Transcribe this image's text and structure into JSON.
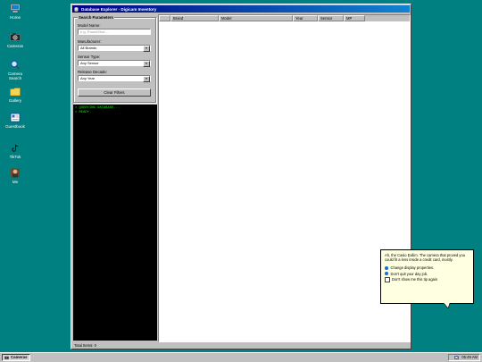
{
  "desktop": {
    "icons": [
      {
        "label": "Home",
        "icon": "computer-icon"
      },
      {
        "label": "Cameras",
        "icon": "camera-icon"
      },
      {
        "label": "Camera\nSearch",
        "icon": "magnifier-icon"
      },
      {
        "label": "Gallery",
        "icon": "folder-icon"
      },
      {
        "label": "Guestbook",
        "icon": "book-icon"
      },
      {
        "label": "TikTok",
        "icon": "tiktok-icon"
      },
      {
        "label": "Me",
        "icon": "person-icon"
      }
    ]
  },
  "window": {
    "title": "Database Explorer - Digicam Inventory",
    "search": {
      "legend": "Search Parameters",
      "model_label": "Model Name:",
      "model_placeholder": "e.g. PowerShot...",
      "manufacturer_label": "Manufacturer:",
      "manufacturer_value": "All Brands",
      "sensor_label": "Sensor Type:",
      "sensor_value": "Any Sensor",
      "decade_label": "Release Decade:",
      "decade_value": "Any Year",
      "clear_button": "Clear Filters"
    },
    "console": {
      "lines": [
        "> QUERYING DATABASE...",
        "> READY."
      ]
    },
    "grid": {
      "columns": [
        "",
        "Brand",
        "Model",
        "Year",
        "Sensor",
        "MP"
      ]
    },
    "status": "Total Items: 0"
  },
  "tip": {
    "text": "Ah, the Casio Exilim. The camera that proved you could fit a lens inside a credit card, mostly.",
    "options": [
      "Change display properties.",
      "Don't quit your day job."
    ],
    "checkbox": "Don't show me this tip again"
  },
  "taskbar": {
    "task_label": "Cameras",
    "clock": "05:49 AM"
  },
  "colors": {
    "desktop": "#008080",
    "title_start": "#000080",
    "title_end": "#1084d0",
    "console_text": "#00ff00",
    "tip_bg": "#ffffe1"
  }
}
